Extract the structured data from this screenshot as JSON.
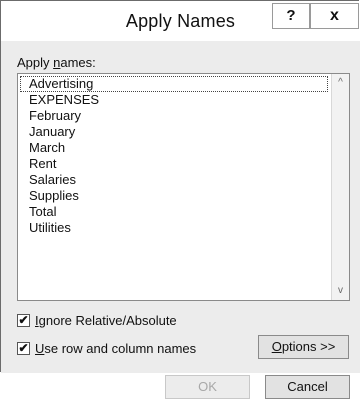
{
  "dialog": {
    "title": "Apply Names",
    "help_label": "?",
    "close_label": "x"
  },
  "apply_names": {
    "label_pre": "Apply ",
    "label_underlined": "n",
    "label_post": "ames:",
    "items": [
      {
        "label": "Advertising",
        "selected": true
      },
      {
        "label": "EXPENSES",
        "selected": false
      },
      {
        "label": "February",
        "selected": false
      },
      {
        "label": "January",
        "selected": false
      },
      {
        "label": "March",
        "selected": false
      },
      {
        "label": "Rent",
        "selected": false
      },
      {
        "label": "Salaries",
        "selected": false
      },
      {
        "label": "Supplies",
        "selected": false
      },
      {
        "label": "Total",
        "selected": false
      },
      {
        "label": "Utilities",
        "selected": false
      }
    ],
    "scroll_up_glyph": "^",
    "scroll_down_glyph": "v"
  },
  "options": {
    "ignore_relative": {
      "checked": true,
      "mark": "✔",
      "label_underlined": "I",
      "label_rest": "gnore Relative/Absolute"
    },
    "use_row_col": {
      "checked": true,
      "mark": "✔",
      "label_underlined": "U",
      "label_rest": "se row and column names"
    },
    "options_button": {
      "label_underlined": "O",
      "label_rest": "ptions >>"
    }
  },
  "buttons": {
    "ok": {
      "label": "OK",
      "enabled": false
    },
    "cancel": {
      "label": "Cancel",
      "enabled": true
    }
  }
}
